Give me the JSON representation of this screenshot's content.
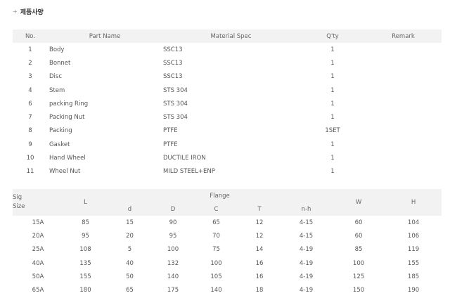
{
  "section_title": "제품사양",
  "bullet": "+",
  "parts_table": {
    "headers": {
      "no": "No.",
      "part_name": "Part Name",
      "material_spec": "Material Spec",
      "qty": "Q'ty",
      "remark": "Remark"
    },
    "rows": [
      {
        "no": "1",
        "part_name": "Body",
        "material_spec": "SSC13",
        "qty": "1",
        "remark": ""
      },
      {
        "no": "2",
        "part_name": "Bonnet",
        "material_spec": "SSC13",
        "qty": "1",
        "remark": ""
      },
      {
        "no": "3",
        "part_name": "Disc",
        "material_spec": "SSC13",
        "qty": "1",
        "remark": ""
      },
      {
        "no": "4",
        "part_name": "Stem",
        "material_spec": "STS 304",
        "qty": "1",
        "remark": ""
      },
      {
        "no": "6",
        "part_name": "packing Ring",
        "material_spec": "STS 304",
        "qty": "1",
        "remark": ""
      },
      {
        "no": "7",
        "part_name": "Packing Nut",
        "material_spec": "STS 304",
        "qty": "1",
        "remark": ""
      },
      {
        "no": "8",
        "part_name": "Packing",
        "material_spec": "PTFE",
        "qty": "1SET",
        "remark": ""
      },
      {
        "no": "9",
        "part_name": "Gasket",
        "material_spec": "PTFE",
        "qty": "1",
        "remark": ""
      },
      {
        "no": "10",
        "part_name": "Hand Wheel",
        "material_spec": "DUCTILE IRON",
        "qty": "1",
        "remark": ""
      },
      {
        "no": "11",
        "part_name": "Wheel Nut",
        "material_spec": "MILD STEEL+ENP",
        "qty": "1",
        "remark": ""
      }
    ]
  },
  "dimension_table": {
    "headers": {
      "sig_size_line1": "Sig",
      "sig_size_line2": "Size",
      "L": "L",
      "flange": "Flange",
      "d": "d",
      "D": "D",
      "C": "C",
      "T": "T",
      "n_h": "n-h",
      "W": "W",
      "H": "H"
    },
    "rows": [
      {
        "size": "15A",
        "L": "85",
        "d": "15",
        "D": "90",
        "C": "65",
        "T": "12",
        "n_h": "4-15",
        "W": "60",
        "H": "104"
      },
      {
        "size": "20A",
        "L": "95",
        "d": "20",
        "D": "95",
        "C": "70",
        "T": "12",
        "n_h": "4-15",
        "W": "60",
        "H": "106"
      },
      {
        "size": "25A",
        "L": "108",
        "d": "5",
        "D": "100",
        "C": "75",
        "T": "14",
        "n_h": "4-19",
        "W": "85",
        "H": "119"
      },
      {
        "size": "40A",
        "L": "135",
        "d": "40",
        "D": "132",
        "C": "100",
        "T": "16",
        "n_h": "4-19",
        "W": "100",
        "H": "155"
      },
      {
        "size": "50A",
        "L": "155",
        "d": "50",
        "D": "140",
        "C": "105",
        "T": "16",
        "n_h": "4-19",
        "W": "125",
        "H": "185"
      },
      {
        "size": "65A",
        "L": "180",
        "d": "65",
        "D": "175",
        "C": "140",
        "T": "18",
        "n_h": "4-19",
        "W": "150",
        "H": "190"
      }
    ]
  }
}
